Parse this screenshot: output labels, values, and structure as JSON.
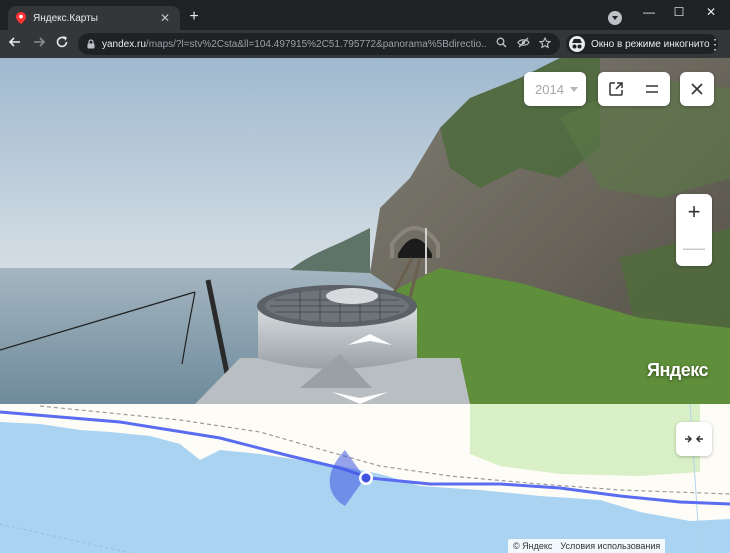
{
  "browser": {
    "tab_title": "Яндекс.Карты",
    "tab_close": "✕",
    "new_tab": "+",
    "url_host": "yandex.ru",
    "url_path": "/maps/?l=stv%2Csta&ll=104.497915%2C51.795772&panorama%5Bdirectio...",
    "incognito_label": "Окно в режиме инкогнито",
    "window_min": "—",
    "window_max": "☐",
    "window_close": "✕"
  },
  "panorama": {
    "year_label": "2014",
    "logo": "Яндекс",
    "zoom_in": "+",
    "zoom_out": "—"
  },
  "map": {
    "copyright": "© Яндекс",
    "terms": "Условия использования"
  },
  "colors": {
    "route": "#5a6cf0",
    "water": "#a9d3f1",
    "land": "#fdfcf6",
    "park": "#d9efc5",
    "accent_marker": "#3f55e0"
  },
  "icons": {
    "favicon": "map-pin-icon",
    "share": "share-icon",
    "menu": "hamburger-icon",
    "close": "close-icon",
    "collapse": "collapse-arrows-icon"
  }
}
